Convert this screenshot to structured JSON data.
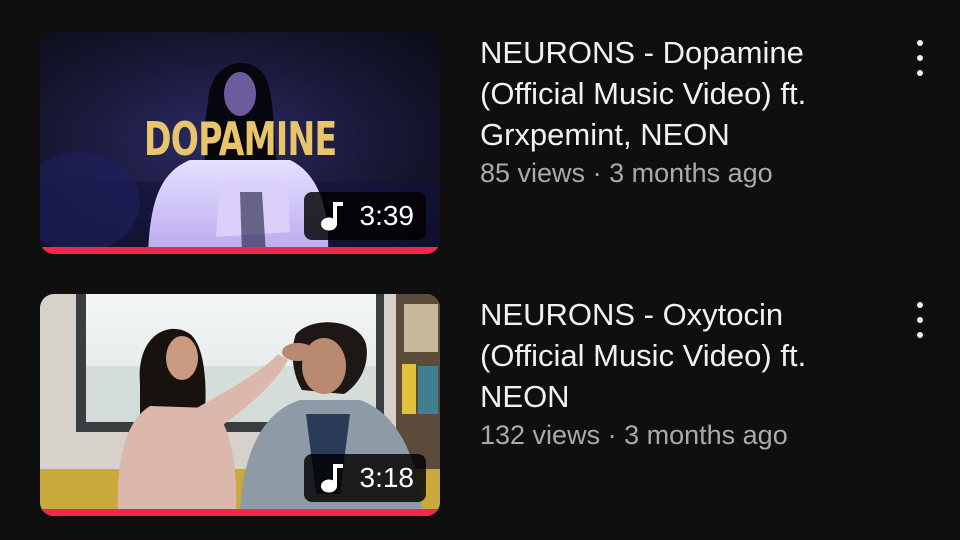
{
  "colors": {
    "background": "#0f0f0f",
    "title_text": "#f1f1f1",
    "meta_text": "#aaaaaa",
    "progress": "#f2284b",
    "thumb_title": "#e8c46c"
  },
  "videos": [
    {
      "title": "NEURONS - Dopamine (Official Music Video) ft. Grxpemint, NEON",
      "thumbnail_text": "DOPAMINE",
      "duration": "3:39",
      "views": "85 views",
      "separator": "·",
      "age": "3 months ago",
      "watched_fraction": 1.0,
      "badge_icon": "music-note-icon",
      "menu_icon": "more-vert-icon"
    },
    {
      "title": "NEURONS - Oxytocin (Official Music Video) ft. NEON",
      "duration": "3:18",
      "views": "132 views",
      "separator": "·",
      "age": "3 months ago",
      "watched_fraction": 1.0,
      "badge_icon": "music-note-icon",
      "menu_icon": "more-vert-icon"
    }
  ]
}
